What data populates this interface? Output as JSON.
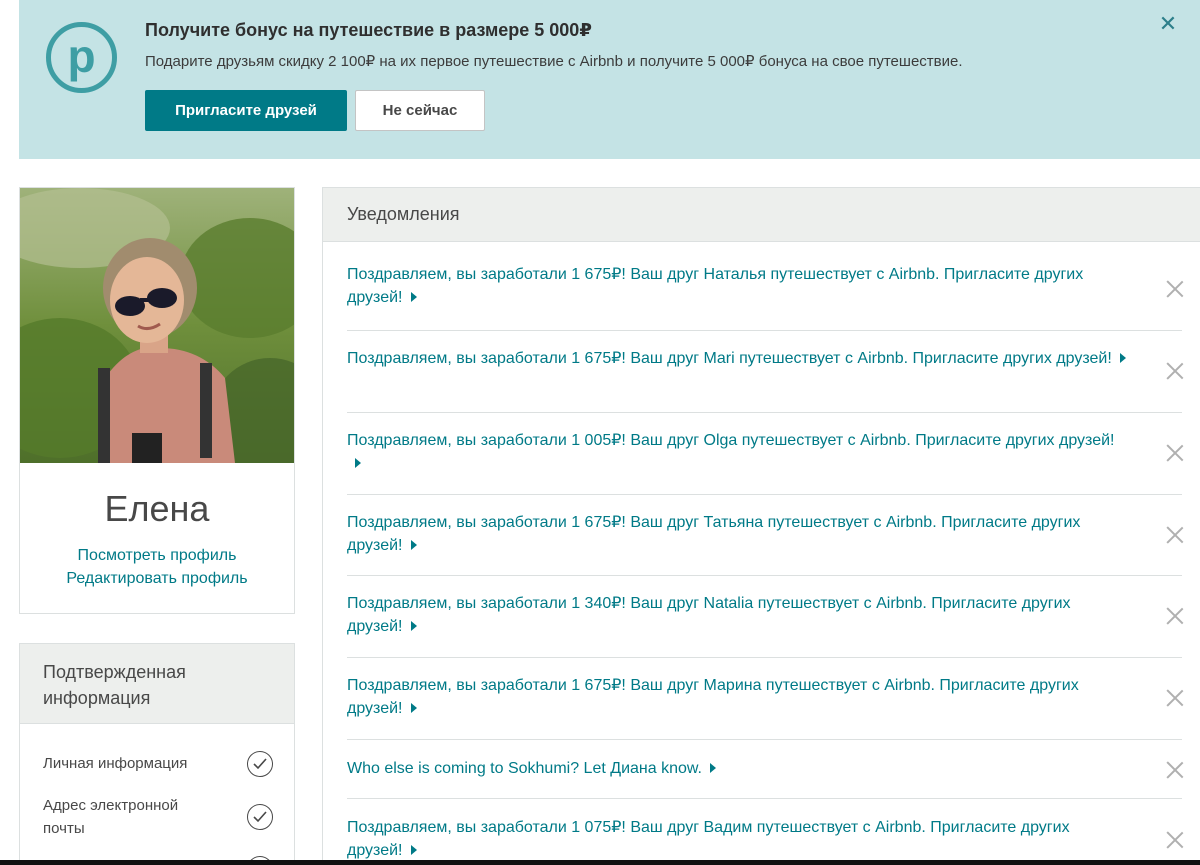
{
  "banner": {
    "logo_letter": "p",
    "title": "Получите бонус на путешествие в размере 5 000₽",
    "text": "Подарите друзьям скидку 2 100₽ на их первое путешествие с Airbnb и получите 5 000₽ бонуса на свое путешествие.",
    "invite_label": "Пригласите друзей",
    "later_label": "Не сейчас",
    "close_glyph": "✕"
  },
  "profile": {
    "name": "Елена",
    "view_link": "Посмотреть профиль",
    "edit_link": "Редактировать профиль"
  },
  "verified": {
    "title": "Подтвержденная информация",
    "items": [
      {
        "label": "Личная информация"
      },
      {
        "label": "Адрес электронной почты"
      }
    ]
  },
  "notifications": {
    "title": "Уведомления",
    "items": [
      {
        "text": "Поздравляем, вы заработали 1 675₽! Ваш друг Наталья путешествует с Airbnb. Пригласите других друзей!"
      },
      {
        "text": "Поздравляем, вы заработали 1 675₽! Ваш друг Mari путешествует с Airbnb. Пригласите других друзей!"
      },
      {
        "text": "Поздравляем, вы заработали 1 005₽! Ваш друг Olga путешествует с Airbnb. Пригласите других друзей!"
      },
      {
        "text": "Поздравляем, вы заработали 1 675₽! Ваш друг Татьяна путешествует с Airbnb. Пригласите других друзей!"
      },
      {
        "text": "Поздравляем, вы заработали 1 340₽! Ваш друг Natalia путешествует с Airbnb. Пригласите других друзей!"
      },
      {
        "text": "Поздравляем, вы заработали 1 675₽! Ваш друг Марина путешествует с Airbnb. Пригласите других друзей!"
      },
      {
        "text": "Who else is coming to Sokhumi? Let Диана know."
      },
      {
        "text": "Поздравляем, вы заработали 1 075₽! Ваш друг Вадим путешествует с Airbnb. Пригласите других друзей!"
      }
    ]
  },
  "colors": {
    "banner_bg": "#c4e3e5",
    "accent": "#007a87",
    "logo": "#3e9ea4",
    "panel_head_bg": "#edefed"
  },
  "icons": [
    "p-logo-icon",
    "close-icon",
    "check-circle-icon",
    "caret-right-icon"
  ]
}
